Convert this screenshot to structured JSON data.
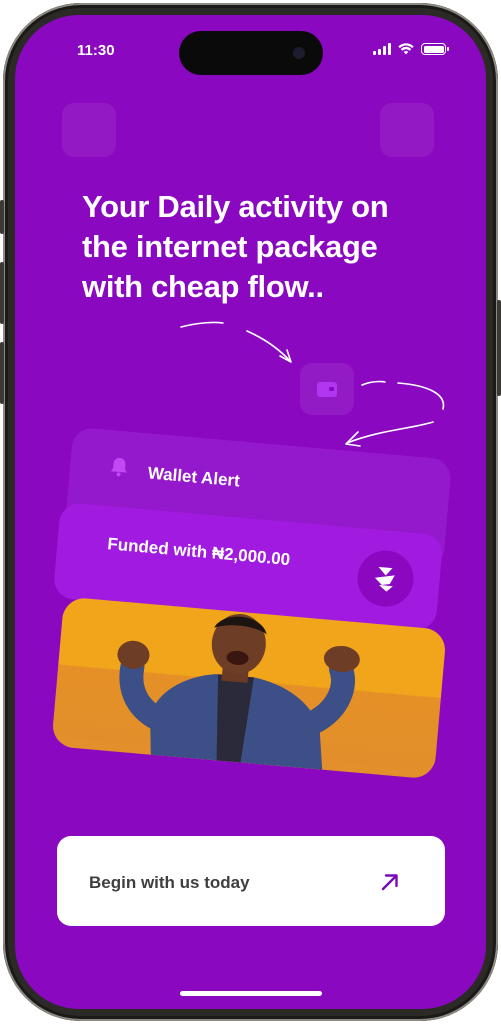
{
  "status_bar": {
    "time": "11:30"
  },
  "onboarding": {
    "headline": "Your Daily activity on the internet package with cheap flow..",
    "notification": {
      "title": "Wallet Alert",
      "message": "Funded with ₦2,000.00"
    },
    "cta_label": "Begin with us today"
  },
  "colors": {
    "background": "#8a08c0",
    "card": "#a11ae0",
    "accent_photo": "#f1a51a",
    "button": "#ffffff"
  },
  "icons": [
    "signal-icon",
    "wifi-icon",
    "battery-icon",
    "wallet-icon",
    "bell-icon",
    "brand-logo-icon",
    "arrow-up-right-icon"
  ]
}
